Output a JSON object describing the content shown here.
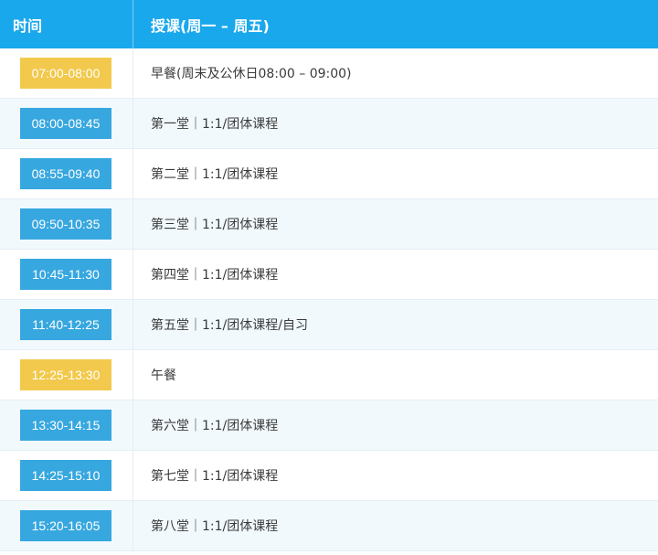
{
  "header": {
    "time_label": "时间",
    "course_label": "授课(周一 – 周五)"
  },
  "colors": {
    "header_bg": "#1aa8ec",
    "class_badge": "#37a7df",
    "meal_badge": "#f2c94c"
  },
  "rows": [
    {
      "time": "07:00-08:00",
      "desc": "早餐(周末及公休日08:00 – 09:00)",
      "kind": "meal"
    },
    {
      "time": "08:00-08:45",
      "desc": "第一堂｜1:1/团体课程",
      "kind": "class"
    },
    {
      "time": "08:55-09:40",
      "desc": "第二堂｜1:1/团体课程",
      "kind": "class"
    },
    {
      "time": "09:50-10:35",
      "desc": "第三堂｜1:1/团体课程",
      "kind": "class"
    },
    {
      "time": "10:45-11:30",
      "desc": "第四堂｜1:1/团体课程",
      "kind": "class"
    },
    {
      "time": "11:40-12:25",
      "desc": "第五堂｜1:1/团体课程/自习",
      "kind": "class"
    },
    {
      "time": "12:25-13:30",
      "desc": "午餐",
      "kind": "meal"
    },
    {
      "time": "13:30-14:15",
      "desc": "第六堂｜1:1/团体课程",
      "kind": "class"
    },
    {
      "time": "14:25-15:10",
      "desc": "第七堂｜1:1/团体课程",
      "kind": "class"
    },
    {
      "time": "15:20-16:05",
      "desc": "第八堂｜1:1/团体课程",
      "kind": "class"
    }
  ]
}
